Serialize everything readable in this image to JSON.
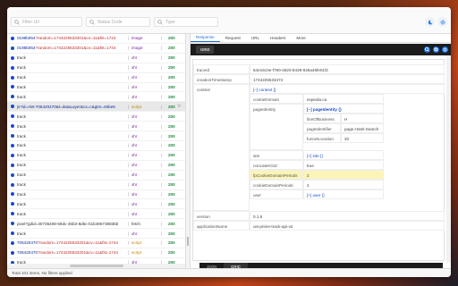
{
  "filters": {
    "url_placeholder": "Filter Url",
    "status_placeholder": "Status Code",
    "type_placeholder": "Type"
  },
  "rows": [
    {
      "name_hl": "0198b054",
      "name_rest": "?random=1744225533201&cv=11&fst=1744",
      "type": "image",
      "type_style": "image",
      "status": "200",
      "tag": ""
    },
    {
      "name_hl": "0198b054",
      "name_rest": "?random=1744225533201&cv=11&fst=1744",
      "type": "image",
      "type_style": "image",
      "status": "200",
      "tag": ""
    },
    {
      "name_hl": "",
      "name_rest": "track",
      "type": "xhr",
      "type_style": "image",
      "status": "200",
      "tag": ""
    },
    {
      "name_hl": "",
      "name_rest": "track",
      "type": "xhr",
      "type_style": "image",
      "status": "200",
      "tag": ""
    },
    {
      "name_hl": "",
      "name_rest": "track",
      "type": "xhr",
      "type_style": "image",
      "status": "200",
      "tag": ""
    },
    {
      "name_hl": "",
      "name_rest": "track",
      "type": "xhr",
      "type_style": "image",
      "status": "200",
      "tag": ""
    },
    {
      "name_hl": "",
      "name_rest": "track",
      "type": "xhr",
      "type_style": "image",
      "status": "200",
      "tag": ""
    },
    {
      "name_hl": "js?id=AW-706420470&l=dataLayer&cx=c&gtm=45be5",
      "name_rest": "",
      "type": "script",
      "type_style": "script",
      "status": "200",
      "tag": "☆"
    },
    {
      "name_hl": "",
      "name_rest": "track",
      "type": "xhr",
      "type_style": "image",
      "status": "200",
      "tag": ""
    },
    {
      "name_hl": "",
      "name_rest": "track",
      "type": "xhr",
      "type_style": "image",
      "status": "200",
      "tag": ""
    },
    {
      "name_hl": "",
      "name_rest": "track",
      "type": "xhr",
      "type_style": "image",
      "status": "200",
      "tag": ""
    },
    {
      "name_hl": "",
      "name_rest": "track",
      "type": "xhr",
      "type_style": "image",
      "status": "200",
      "tag": ""
    },
    {
      "name_hl": "",
      "name_rest": "track",
      "type": "xhr",
      "type_style": "image",
      "status": "200",
      "tag": ""
    },
    {
      "name_hl": "",
      "name_rest": "track",
      "type": "xhr",
      "type_style": "image",
      "status": "200",
      "tag": ""
    },
    {
      "name_hl": "",
      "name_rest": "track",
      "type": "xhr",
      "type_style": "image",
      "status": "200",
      "tag": ""
    },
    {
      "name_hl": "",
      "name_rest": "track",
      "type": "xhr",
      "type_style": "image",
      "status": "200",
      "tag": ""
    },
    {
      "name_hl": "",
      "name_rest": "track",
      "type": "xhr",
      "type_style": "image",
      "status": "200",
      "tag": ""
    },
    {
      "name_hl": "",
      "name_rest": "track",
      "type": "xhr",
      "type_style": "image",
      "status": "200",
      "tag": ""
    },
    {
      "name_hl": "",
      "name_rest": "track",
      "type": "xhr",
      "type_style": "image",
      "status": "200",
      "tag": ""
    },
    {
      "name_hl": "",
      "name_rest": "pixel?gdid=30735408-59dc-45b3-8d5c-b1b496738835b",
      "type": "fetch",
      "type_style": "fetch",
      "status": "200",
      "tag": ""
    },
    {
      "name_hl": "",
      "name_rest": "track",
      "type": "xhr",
      "type_style": "image",
      "status": "200",
      "tag": ""
    },
    {
      "name_hl": "706420470",
      "name_rest": "?random=1744225533201&cv=11&fst=1744",
      "type": "script",
      "type_style": "script",
      "status": "200",
      "tag": ""
    },
    {
      "name_hl": "706420470",
      "name_rest": "?random=1744225533201&cv=11&fst=1744",
      "type": "script",
      "type_style": "script",
      "status": "200",
      "tag": ""
    },
    {
      "name_hl": "",
      "name_rest": "track",
      "type": "xhr",
      "type_style": "image",
      "status": "200",
      "tag": ""
    },
    {
      "name_hl": "0198b054",
      "name_rest": "?random=1744225533201&cv=11&fst=1744",
      "type": "image",
      "type_style": "image",
      "status": "200",
      "tag": ""
    }
  ],
  "status_bar": "Total 101 items, No filters applied",
  "right": {
    "tabs": [
      "Response",
      "Request",
      "URL",
      "Headers",
      "More"
    ],
    "active_tab": 0,
    "mode_label": "GRID",
    "grid": {
      "traceId_key": "traceId",
      "traceId_val": "64e16c0e-f790-4820-8439-926a46fe01f2",
      "creation_key": "creationTimestamp",
      "creation_val": "1744225533474",
      "context_key": "context",
      "context_val": "[–] context {}",
      "cookieDomain_key": "cookieDomain",
      "cookieDomain_val": "expedia.ca",
      "pageIdentity_key": "pageIdentity",
      "pageIdentity_val": "[–] pageIdentity {}",
      "lineOfBusiness_key": "lineOfBusiness",
      "lineOfBusiness_val": "H",
      "pageIdentifier_key": "pageIdentifier",
      "pageIdentifier_val": "page.Hotel-Search",
      "funnelLocation_key": "funnelLocation",
      "funnelLocation_val": "20",
      "site_key": "site",
      "site_val": "[+] site {}",
      "noncatekGid_key": "noncateKGid",
      "noncatekGid_val": "true",
      "fpCookieDomainPeriods_key": "fpCookieDomainPeriods",
      "fpCookieDomainPeriods_val": "2",
      "cookieDomainPeriods_key": "cookieDomainPeriods",
      "cookieDomainPeriods_val": "2",
      "user_key": "user",
      "user_val": "[+] user {}",
      "version_key": "version",
      "version_val": "0.1.6",
      "applicationName_key": "applicationName",
      "applicationName_val": "uis-prime-track-api-v2"
    },
    "bottom_tabs": [
      "JSON",
      "GRID"
    ]
  },
  "colors": {
    "accent": "#1a73e8",
    "status_ok": "#1a8a3a",
    "type_image": "#7a1fa2",
    "type_script": "#b8860b",
    "highlight": "#fbf4b6"
  }
}
